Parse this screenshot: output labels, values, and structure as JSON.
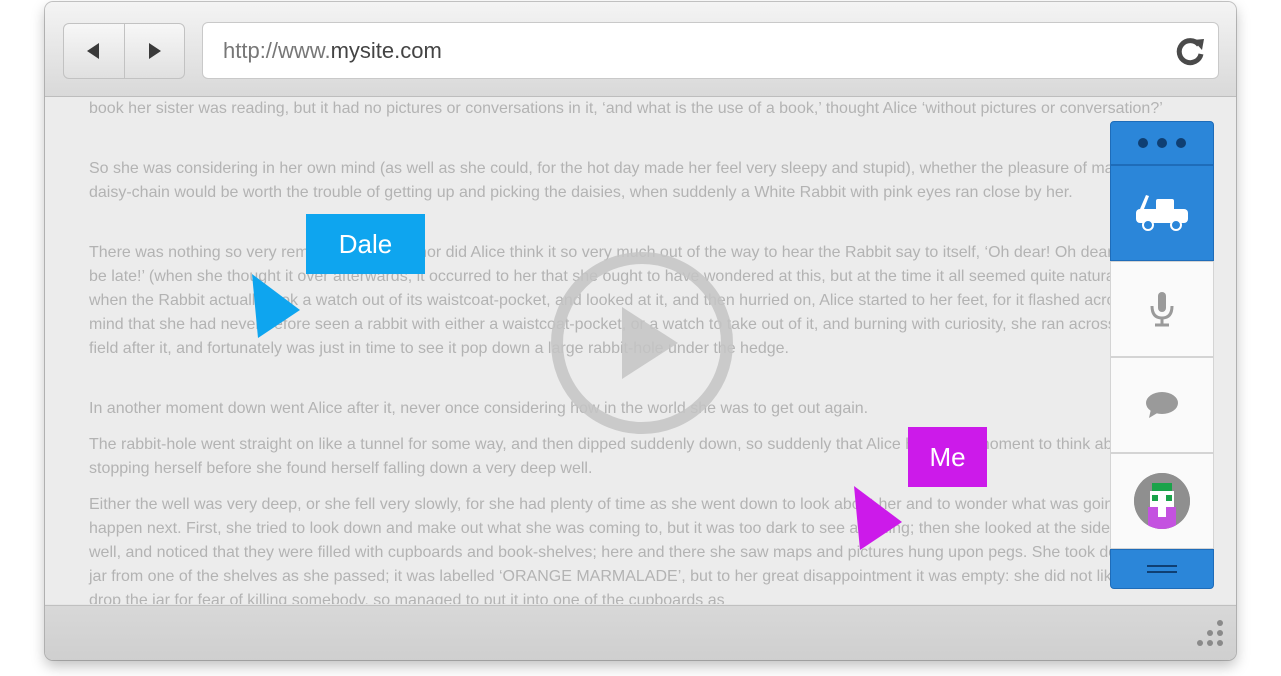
{
  "browser": {
    "url_prefix": "http://www.",
    "url_domain": "mysite.com",
    "back_icon": "back-arrow-icon",
    "forward_icon": "forward-arrow-icon",
    "reload_icon": "reload-icon"
  },
  "content": {
    "paragraphs": [
      "book her sister was reading, but it had no pictures or conversations in it, ‘and what is the use of a book,’ thought Alice ‘without pictures or conversation?’",
      "So she was considering in her own mind (as well as she could, for the hot day made her feel very sleepy and stupid), whether the pleasure of making a daisy-chain would be worth the trouble of getting up and picking the daisies, when suddenly a White Rabbit with pink eyes ran close by her.",
      "There was nothing so very remarkable in that; nor did Alice think it so very much out of the way to hear the Rabbit say to itself, ‘Oh dear! Oh dear! I shall be late!’ (when she thought it over afterwards, it occurred to her that she ought to have wondered at this, but at the time it all seemed quite natural); but when the Rabbit actually took a watch out of its waistcoat-pocket, and looked at it, and then hurried on, Alice started to her feet, for it flashed across her mind that she had never before seen a rabbit with either a waistcoat-pocket, or a watch to take out of it, and burning with curiosity, she ran across the field after it, and fortunately was just in time to see it pop down a large rabbit-hole under the hedge.",
      "In another moment down went Alice after it, never once considering how in the world she was to get out again.",
      "The rabbit-hole went straight on like a tunnel for some way, and then dipped suddenly down, so suddenly that Alice had not a moment to think about stopping herself before she found herself falling down a very deep well.",
      "Either the well was very deep, or she fell very slowly, for she had plenty of time as she went down to look about her and to wonder what was going to happen next. First, she tried to look down and make out what she was coming to, but it was too dark to see anything; then she looked at the sides of the well, and noticed that they were filled with cupboards and book-shelves; here and there she saw maps and pictures hung upon pegs. She took down a jar from one of the shelves as she passed; it was labelled ‘ORANGE MARMALADE’, but to her great disappointment it was empty: she did not like to drop the jar for fear of killing somebody, so managed to put it into one of the cupboards as"
    ],
    "play_icon": "play-circle-icon"
  },
  "collaborators": {
    "dale": {
      "label": "Dale",
      "color": "#0ea5ef"
    },
    "me": {
      "label": "Me",
      "color": "#cc1aea"
    }
  },
  "side_panel": {
    "accent": "#2b86d9",
    "items": [
      {
        "icon": "more-dots-icon"
      },
      {
        "icon": "tow-truck-icon"
      },
      {
        "icon": "microphone-icon"
      },
      {
        "icon": "chat-bubble-icon"
      },
      {
        "icon": "avatar-icon"
      },
      {
        "icon": "menu-lines-icon"
      }
    ]
  },
  "statusbar": {
    "icon": "resize-grip-icon"
  }
}
